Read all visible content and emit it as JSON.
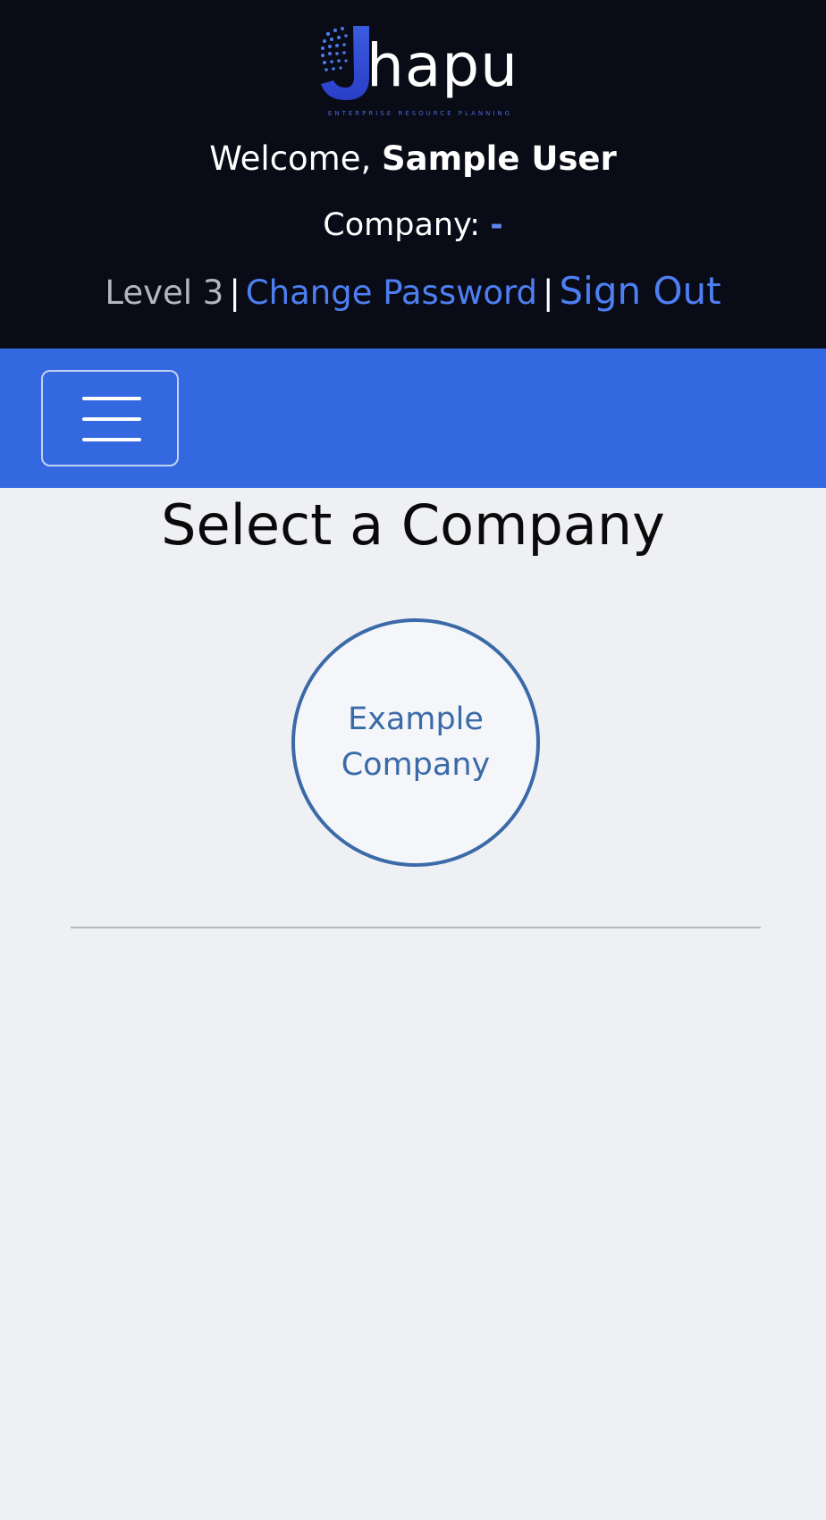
{
  "header": {
    "logo": {
      "name": "Jhapu",
      "word": "hapu",
      "tagline": "ENTERPRISE RESOURCE PLANNING",
      "icon": "fingerprint-j-logo"
    },
    "welcome_prefix": "Welcome,",
    "user_name": "Sample User",
    "company_label": "Company:",
    "company_value": "-",
    "level": "Level 3",
    "separator": "|",
    "change_password": "Change Password",
    "sign_out": "Sign Out"
  },
  "navbar": {
    "menu_icon": "hamburger-menu-icon",
    "accent_color": "#3468e0"
  },
  "main": {
    "title": "Select a Company",
    "companies": [
      {
        "name": "Example Company"
      }
    ]
  },
  "colors": {
    "header_bg": "#090b16",
    "link": "#4d7ff2",
    "company_circle": "#3b6aa8",
    "page_bg": "#eff0f4"
  }
}
